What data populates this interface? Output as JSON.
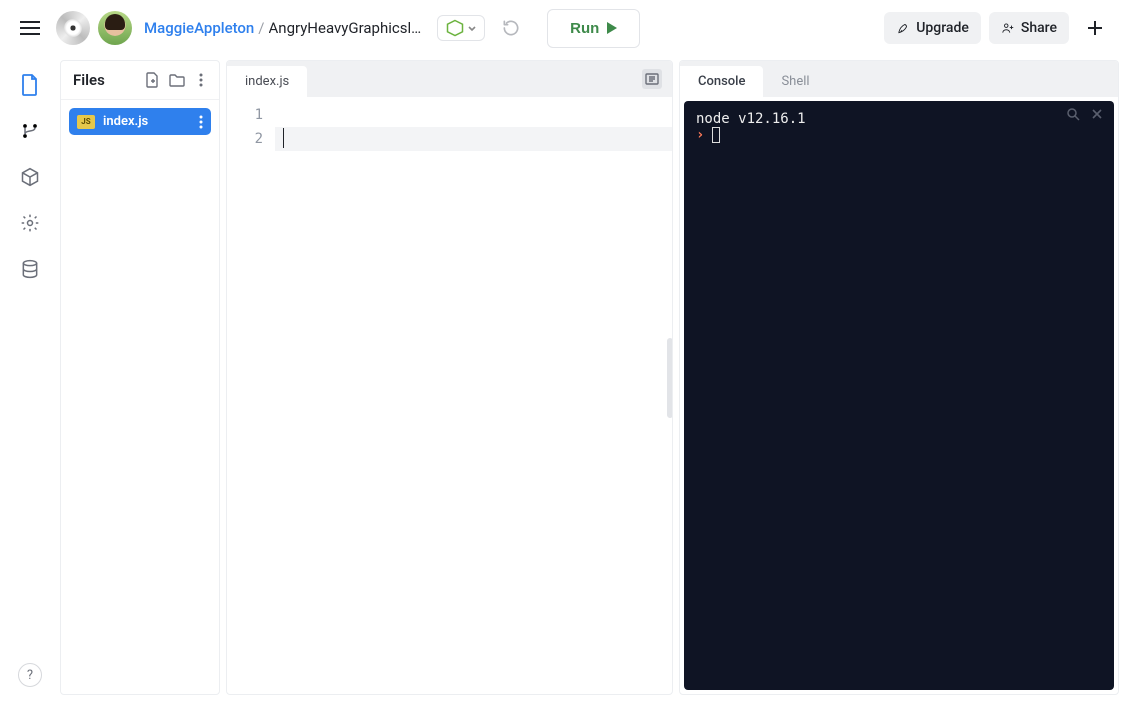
{
  "colors": {
    "terminal_bg": "#0f1424",
    "accent_blue": "#2f80ed",
    "run_green": "#3e8a4a"
  },
  "header": {
    "user": "MaggieAppleton",
    "separator": "/",
    "repl_name": "AngryHeavyGraphicsl…",
    "run_label": "Run",
    "upgrade_label": "Upgrade",
    "share_label": "Share"
  },
  "sidebar": {
    "title": "Files",
    "icons": {
      "new_file": "new-file",
      "new_folder": "new-folder",
      "more": "more"
    },
    "files": [
      {
        "badge": "JS",
        "name": "index.js"
      }
    ]
  },
  "editor": {
    "tab": "index.js",
    "line_numbers": [
      "1",
      "2"
    ]
  },
  "terminal": {
    "tabs": {
      "console": "Console",
      "shell": "Shell"
    },
    "banner": "node v12.16.1",
    "prompt": ""
  },
  "help": "?"
}
